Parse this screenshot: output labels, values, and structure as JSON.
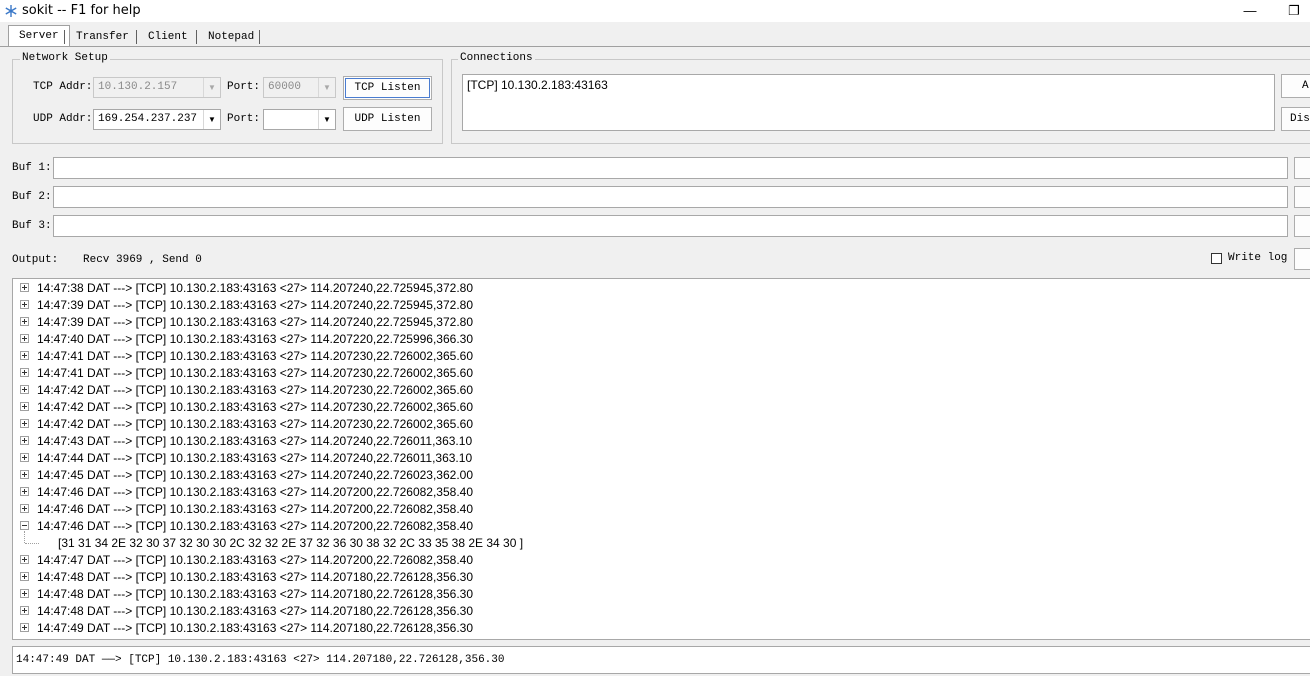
{
  "window": {
    "title": "sokit -- F1 for help",
    "minimize_glyph": "—",
    "restore_glyph": "❐"
  },
  "tabs": [
    {
      "label": "Server",
      "active": true
    },
    {
      "label": "Transfer",
      "active": false
    },
    {
      "label": "Client",
      "active": false
    },
    {
      "label": "Notepad",
      "active": false
    }
  ],
  "network_setup": {
    "title": "Network Setup",
    "tcp_addr_label": "TCP Addr:",
    "tcp_addr_value": "10.130.2.157",
    "tcp_port_label": "Port:",
    "tcp_port_value": "60000",
    "tcp_listen_label": "TCP Listen",
    "udp_addr_label": "UDP Addr:",
    "udp_addr_value": "169.254.237.237",
    "udp_port_label": "Port:",
    "udp_port_value": "",
    "udp_listen_label": "UDP Listen"
  },
  "connections": {
    "title": "Connections",
    "items": [
      "[TCP] 10.130.2.183:43163"
    ],
    "button_all": "Al",
    "button_disconnect": "Dis"
  },
  "buffers": [
    {
      "label": "Buf 1:",
      "value": ""
    },
    {
      "label": "Buf 2:",
      "value": ""
    },
    {
      "label": "Buf 3:",
      "value": ""
    }
  ],
  "output": {
    "label": "Output:",
    "stats": "Recv 3969 , Send 0",
    "write_log_label": "Write log",
    "write_log_checked": false
  },
  "log_rows": [
    {
      "text": "14:47:38 DAT ---> [TCP] 10.130.2.183:43163 <27> 114.207240,22.725945,372.80",
      "expanded": false
    },
    {
      "text": "14:47:39 DAT ---> [TCP] 10.130.2.183:43163 <27> 114.207240,22.725945,372.80",
      "expanded": false
    },
    {
      "text": "14:47:39 DAT ---> [TCP] 10.130.2.183:43163 <27> 114.207240,22.725945,372.80",
      "expanded": false
    },
    {
      "text": "14:47:40 DAT ---> [TCP] 10.130.2.183:43163 <27> 114.207220,22.725996,366.30",
      "expanded": false
    },
    {
      "text": "14:47:41 DAT ---> [TCP] 10.130.2.183:43163 <27> 114.207230,22.726002,365.60",
      "expanded": false
    },
    {
      "text": "14:47:41 DAT ---> [TCP] 10.130.2.183:43163 <27> 114.207230,22.726002,365.60",
      "expanded": false
    },
    {
      "text": "14:47:42 DAT ---> [TCP] 10.130.2.183:43163 <27> 114.207230,22.726002,365.60",
      "expanded": false
    },
    {
      "text": "14:47:42 DAT ---> [TCP] 10.130.2.183:43163 <27> 114.207230,22.726002,365.60",
      "expanded": false
    },
    {
      "text": "14:47:42 DAT ---> [TCP] 10.130.2.183:43163 <27> 114.207230,22.726002,365.60",
      "expanded": false
    },
    {
      "text": "14:47:43 DAT ---> [TCP] 10.130.2.183:43163 <27> 114.207240,22.726011,363.10",
      "expanded": false
    },
    {
      "text": "14:47:44 DAT ---> [TCP] 10.130.2.183:43163 <27> 114.207240,22.726011,363.10",
      "expanded": false
    },
    {
      "text": "14:47:45 DAT ---> [TCP] 10.130.2.183:43163 <27> 114.207240,22.726023,362.00",
      "expanded": false
    },
    {
      "text": "14:47:46 DAT ---> [TCP] 10.130.2.183:43163 <27> 114.207200,22.726082,358.40",
      "expanded": false
    },
    {
      "text": "14:47:46 DAT ---> [TCP] 10.130.2.183:43163 <27> 114.207200,22.726082,358.40",
      "expanded": false
    },
    {
      "text": "14:47:46 DAT ---> [TCP] 10.130.2.183:43163 <27> 114.207200,22.726082,358.40",
      "expanded": true,
      "child": "[31 31 34 2E 32 30 37 32 30 30 2C 32 32 2E 37 32 36 30 38 32 2C 33 35 38 2E 34 30 ]"
    },
    {
      "text": "14:47:47 DAT ---> [TCP] 10.130.2.183:43163 <27> 114.207200,22.726082,358.40",
      "expanded": false
    },
    {
      "text": "14:47:48 DAT ---> [TCP] 10.130.2.183:43163 <27> 114.207180,22.726128,356.30",
      "expanded": false
    },
    {
      "text": "14:47:48 DAT ---> [TCP] 10.130.2.183:43163 <27> 114.207180,22.726128,356.30",
      "expanded": false
    },
    {
      "text": "14:47:48 DAT ---> [TCP] 10.130.2.183:43163 <27> 114.207180,22.726128,356.30",
      "expanded": false
    },
    {
      "text": "14:47:49 DAT ---> [TCP] 10.130.2.183:43163 <27> 114.207180,22.726128,356.30",
      "expanded": false
    }
  ],
  "status": {
    "text": "14:47:49 DAT ——> [TCP] 10.130.2.183:43163 <27> 114.207180,22.726128,356.30"
  },
  "colors": {
    "app_icon": "#3a78c8",
    "focus_outline": "#4a7cd0"
  }
}
